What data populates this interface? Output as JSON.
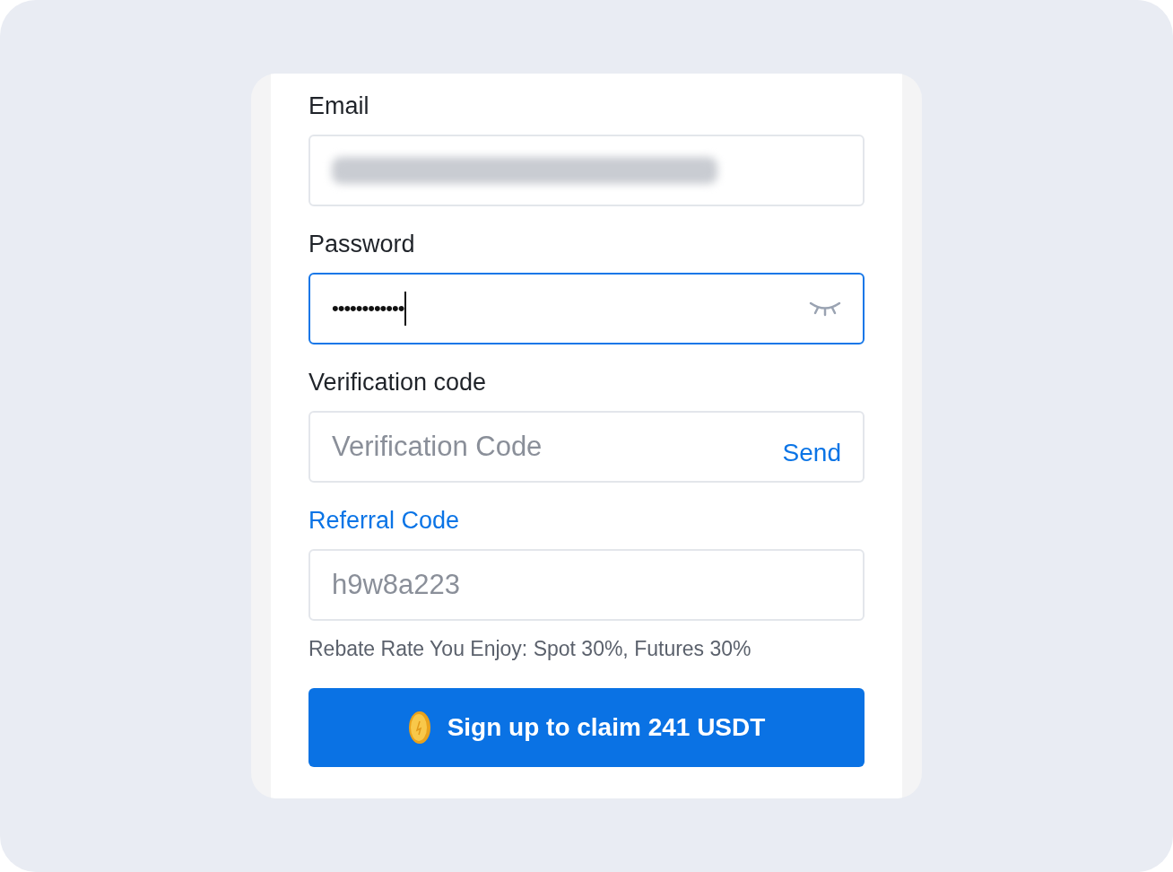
{
  "form": {
    "fields": [
      {
        "kind": "blurred",
        "label": "Email",
        "focused": false
      },
      {
        "kind": "password",
        "label": "Password",
        "value": "••••••••••••",
        "focused": true
      },
      {
        "kind": "code",
        "label": "Verification code",
        "placeholder": "Verification Code",
        "action": "Send",
        "focused": false
      },
      {
        "kind": "referral",
        "label": "Referral Code",
        "value": "h9w8a223",
        "focused": false
      }
    ],
    "rebate_note": "Rebate Rate You Enjoy: Spot 30%, Futures 30%",
    "submit": "Sign up to claim 241 USDT"
  }
}
